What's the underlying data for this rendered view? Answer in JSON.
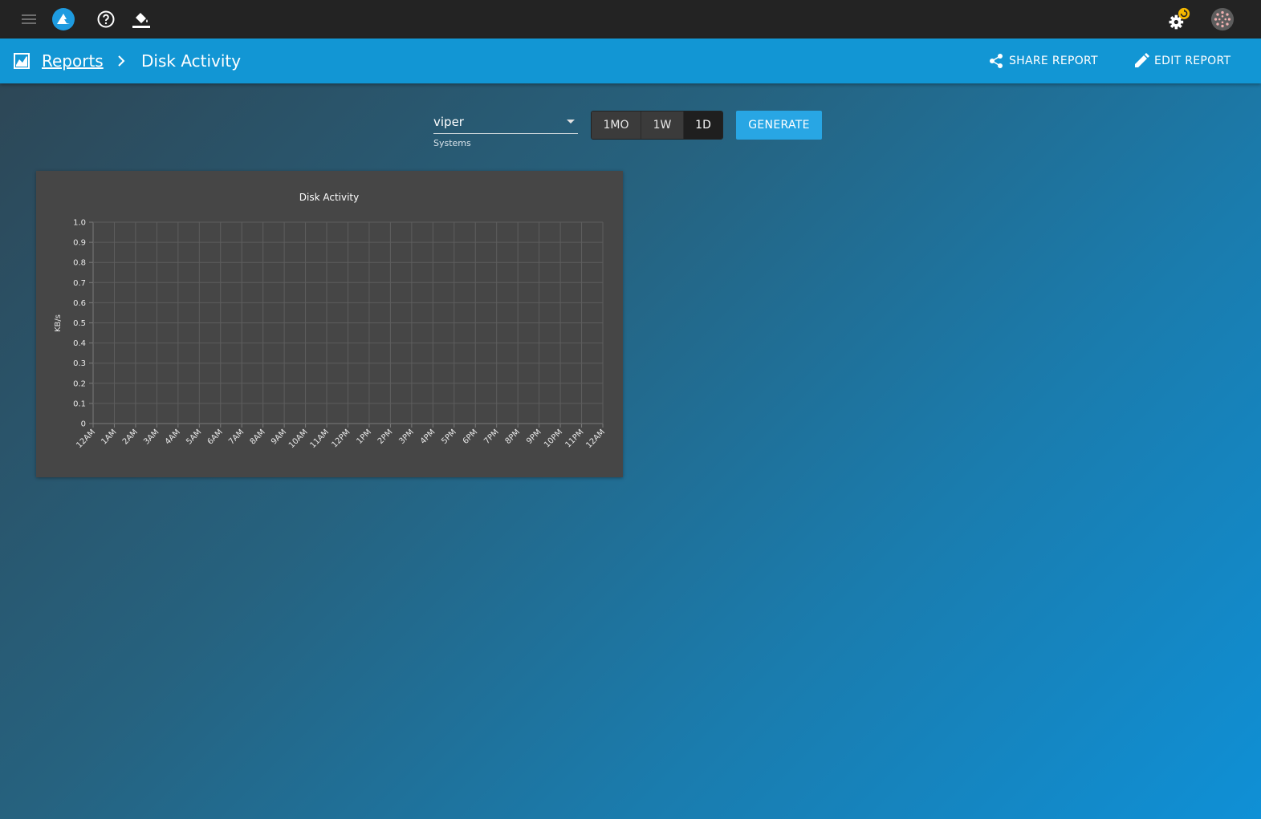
{
  "topbar": {
    "icons": [
      "menu-icon",
      "app-logo-icon",
      "help-icon",
      "paint-bucket-icon",
      "settings-update-icon",
      "avatar-icon"
    ]
  },
  "header": {
    "breadcrumb_root": "Reports",
    "breadcrumb_current": "Disk Activity",
    "share_label": "SHARE REPORT",
    "edit_label": "EDIT REPORT"
  },
  "controls": {
    "system_value": "viper",
    "system_label": "Systems",
    "ranges": [
      "1MO",
      "1W",
      "1D"
    ],
    "selected_range": "1D",
    "generate_label": "GENERATE"
  },
  "chart_data": {
    "type": "line",
    "title": "Disk Activity",
    "xlabel": "",
    "ylabel": "KB/s",
    "ylim": [
      0,
      1.0
    ],
    "yticks": [
      "0",
      "0.1",
      "0.2",
      "0.3",
      "0.4",
      "0.5",
      "0.6",
      "0.7",
      "0.8",
      "0.9",
      "1.0"
    ],
    "categories": [
      "12AM",
      "1AM",
      "2AM",
      "3AM",
      "4AM",
      "5AM",
      "6AM",
      "7AM",
      "8AM",
      "9AM",
      "10AM",
      "11AM",
      "12PM",
      "1PM",
      "2PM",
      "3PM",
      "4PM",
      "5PM",
      "6PM",
      "7PM",
      "8PM",
      "9PM",
      "10PM",
      "11PM",
      "12AM"
    ],
    "series": [],
    "grid": true
  },
  "colors": {
    "topbar": "#232323",
    "header": "#1296d4",
    "accent": "#28a6e4",
    "card": "#464646",
    "badge": "#f5b800"
  }
}
